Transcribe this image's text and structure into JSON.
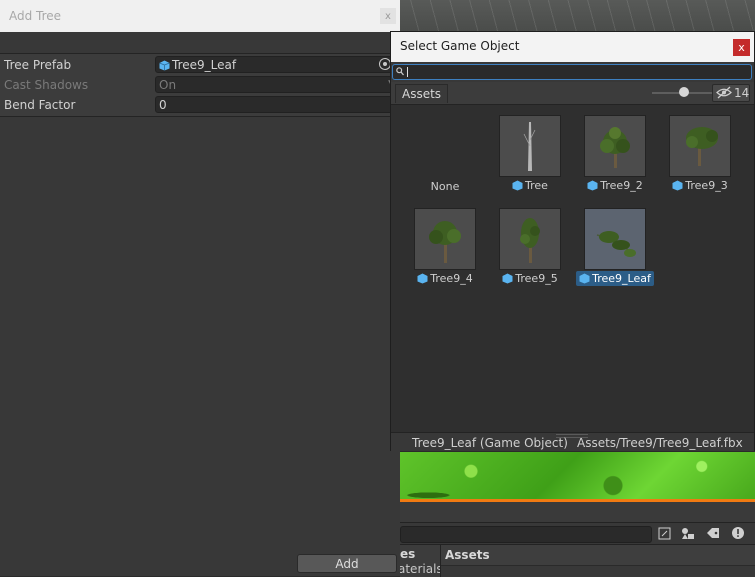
{
  "add_tree": {
    "title": "Add Tree",
    "close_glyph": "x",
    "properties": [
      {
        "label": "Tree Prefab",
        "value": "Tree9_Leaf",
        "type": "object"
      },
      {
        "label": "Cast Shadows",
        "value": "On",
        "type": "dropdown",
        "disabled": true
      },
      {
        "label": "Bend Factor",
        "value": "0",
        "type": "number"
      }
    ],
    "add_button": "Add"
  },
  "select_game_object": {
    "title": "Select Game Object",
    "close_glyph": "x",
    "search": {
      "value": ""
    },
    "tab": "Assets",
    "hidden_count": "14",
    "items": [
      {
        "label": "None",
        "icon": false
      },
      {
        "label": "Tree",
        "icon": true
      },
      {
        "label": "Tree9_2",
        "icon": true
      },
      {
        "label": "Tree9_3",
        "icon": true
      },
      {
        "label": "Tree9_4",
        "icon": true
      },
      {
        "label": "Tree9_5",
        "icon": true
      },
      {
        "label": "Tree9_Leaf",
        "icon": true,
        "selected": true
      }
    ],
    "footer": {
      "name": "Tree9_Leaf (Game Object)",
      "path": "Assets/Tree9/Tree9_Leaf.fbx"
    }
  },
  "background_editor": {
    "bottom_left_line1": "es",
    "bottom_left_line2": "aterials",
    "assets_header": "Assets"
  },
  "colors": {
    "accent_selection": "#2c5d87",
    "search_focus": "#3d7fbf",
    "close_red": "#c42b2b",
    "prefab_icon": "#5ab4f0"
  }
}
